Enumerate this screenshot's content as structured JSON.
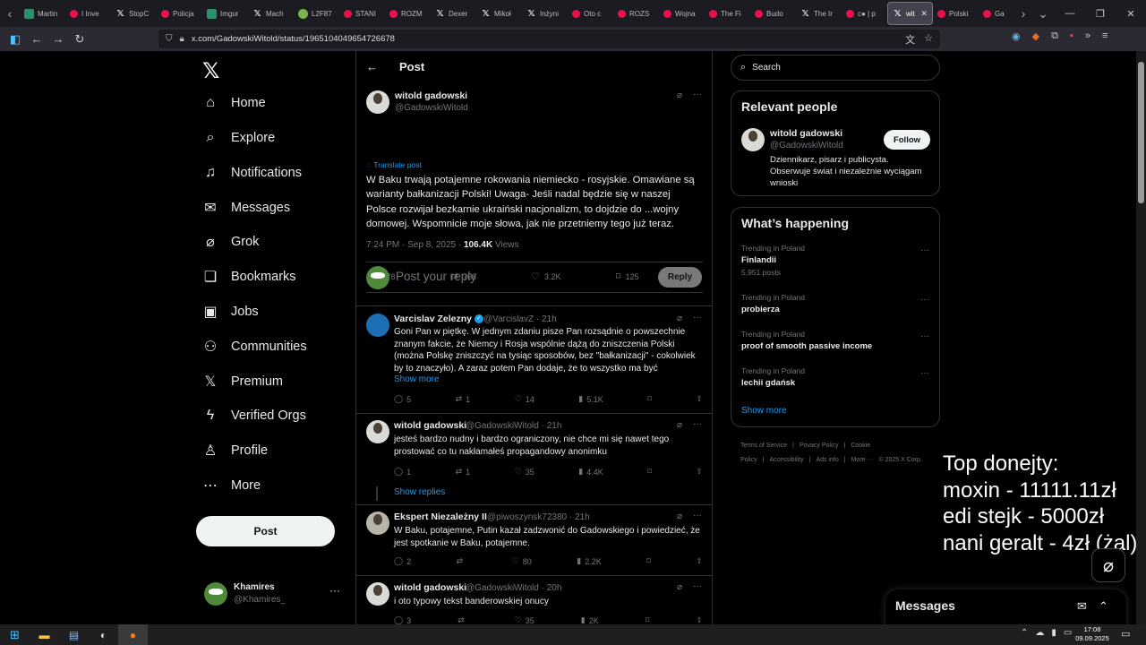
{
  "browser": {
    "tabs": [
      {
        "label": "Martin",
        "icon": "ig-icon"
      },
      {
        "label": "I Inve",
        "icon": "youtube-icon"
      },
      {
        "label": "StopC",
        "icon": "x-icon"
      },
      {
        "label": "Policja",
        "icon": "youtube-icon"
      },
      {
        "label": "Imgur",
        "icon": "ig-icon"
      },
      {
        "label": "Mach",
        "icon": "x-icon"
      },
      {
        "label": "L2F87",
        "icon": "leaf-icon"
      },
      {
        "label": "STANI",
        "icon": "youtube-icon"
      },
      {
        "label": "ROZM",
        "icon": "youtube-icon"
      },
      {
        "label": "Dexer",
        "icon": "x-icon"
      },
      {
        "label": "Mikoł",
        "icon": "x-icon"
      },
      {
        "label": "Inżyni",
        "icon": "x-icon"
      },
      {
        "label": "Oto c",
        "icon": "youtube-icon"
      },
      {
        "label": "ROZS",
        "icon": "youtube-icon"
      },
      {
        "label": "Wojna",
        "icon": "youtube-icon"
      },
      {
        "label": "The Fi",
        "icon": "youtube-icon"
      },
      {
        "label": "Budo",
        "icon": "youtube-icon"
      },
      {
        "label": "The Ir",
        "icon": "x-icon"
      },
      {
        "label": "c● | p",
        "icon": "youtube-icon"
      },
      {
        "label": "wit",
        "icon": "x-icon",
        "active": true
      },
      {
        "label": "Polski",
        "icon": "youtube-icon"
      },
      {
        "label": "Ga",
        "icon": "youtube-icon"
      }
    ],
    "url": "x.com/GadowskiWitold/status/1965104049654726678"
  },
  "nav": {
    "logo": "𝕏",
    "items": [
      {
        "label": "Home",
        "icon": "⌂"
      },
      {
        "label": "Explore",
        "icon": "⌕"
      },
      {
        "label": "Notifications",
        "icon": "♫"
      },
      {
        "label": "Messages",
        "icon": "✉"
      },
      {
        "label": "Grok",
        "icon": "⌀"
      },
      {
        "label": "Bookmarks",
        "icon": "❏"
      },
      {
        "label": "Jobs",
        "icon": "▣"
      },
      {
        "label": "Communities",
        "icon": "⚇"
      },
      {
        "label": "Premium",
        "icon": "𝕏"
      },
      {
        "label": "Verified Orgs",
        "icon": "ϟ"
      },
      {
        "label": "Profile",
        "icon": "♙"
      },
      {
        "label": "More",
        "icon": "⋯"
      }
    ],
    "post_button": "Post",
    "account": {
      "name": "Khamires",
      "handle": "@Khamires_"
    }
  },
  "post_header": {
    "title": "Post"
  },
  "main_post": {
    "author": "witold gadowski",
    "handle": "@GadowskiWitold",
    "translate": "Translate post",
    "text": "W Baku trwają potajemne rokowania niemiecko - rosyjskie. Omawiane są warianty bałkanizacji Polski! Uwaga- Jeśli nadal będzie się w naszej Polsce rozwijał bezkarnie ukraiński nacjonalizm, to dojdzie do ...wojny domowej. Wspomnicie moje słowa, jak nie przetniemy tego już teraz.",
    "timestamp": "7:24 PM · Sep 8, 2025 · ",
    "views": "106.4K",
    "views_label": " Views",
    "stats": {
      "replies": "178",
      "reposts": "768",
      "likes": "3.2K",
      "bookmarks": "125"
    }
  },
  "reply_composer": {
    "placeholder": "Post your reply",
    "button": "Reply"
  },
  "replies": [
    {
      "author": "Varcislav Zelezny",
      "handle": "@VarcislavZ · 21h",
      "text": "Goni Pan w piętkę. W jednym zdaniu pisze Pan rozsądnie o powszechnie znanym fakcie, że Niemcy i Rosja wspólnie dążą do zniszczenia Polski (można Polskę zniszczyć na tysiąc sposobów, bez \"bałkanizacji\" - cokolwiek by to znaczyło). A zaraz potem Pan dodaje, że to wszystko ma być",
      "show_more": "Show more",
      "stats": {
        "replies": "5",
        "reposts": "1",
        "likes": "14",
        "views": "5.1K"
      }
    },
    {
      "author": "witold gadowski",
      "handle": "@GadowskiWitold · 21h",
      "text": "jesteś bardzo nudny i bardzo ograniczony, nie chce mi się nawet tego prostować co tu nakłamałeś propagandowy anonimku",
      "stats": {
        "replies": "1",
        "reposts": "1",
        "likes": "35",
        "views": "4.4K"
      }
    },
    {
      "author": "Ekspert Niezależny II",
      "handle": "@piwoszynsk72380 · 21h",
      "text": "W Baku, potajemne, Putin kazał zadzwonić do Gadowskiego i powiedzieć, że jest spotkanie w Baku, potajemne.",
      "stats": {
        "replies": "2",
        "reposts": "",
        "likes": "80",
        "views": "2.2K"
      }
    },
    {
      "author": "witold gadowski",
      "handle": "@GadowskiWitold · 20h",
      "text": "i oto typowy tekst banderowskiej onucy",
      "stats": {
        "replies": "3",
        "reposts": "",
        "likes": "35",
        "views": "2K"
      }
    }
  ],
  "show_replies": "Show replies",
  "search": {
    "placeholder": "Search"
  },
  "relevant_people": {
    "title": "Relevant people",
    "name": "witold gadowski",
    "handle": "@GadowskiWitold",
    "follow": "Follow",
    "bio": "Dziennikarz, pisarz i publicysta. Obserwuje świat i niezależnie wyciągam wnioski"
  },
  "whats_happening": {
    "title": "What’s happening",
    "trends": [
      {
        "category": "Trending in Poland",
        "name": "Finlandii",
        "posts": "5,951 posts"
      },
      {
        "category": "Trending in Poland",
        "name": "probierza",
        "posts": ""
      },
      {
        "category": "Trending in Poland",
        "name": "proof of smooth passive income",
        "posts": ""
      },
      {
        "category": "Trending in Poland",
        "name": "lechii gdańsk",
        "posts": ""
      }
    ],
    "show_more": "Show more"
  },
  "footer": {
    "links": [
      "Terms of Service",
      "|",
      "Privacy Policy",
      "|",
      "Cookie Policy",
      "|",
      "Accessibility",
      "|",
      "Ads info",
      "|",
      "More ···",
      "© 2025 X Corp."
    ]
  },
  "overlay": {
    "line1": "Top donejty:",
    "line2": "moxin - 11111.11zł",
    "line3": "edi stejk - 5000zł",
    "line4": "nani geralt - 4zł (żal)"
  },
  "messages_drawer": {
    "title": "Messages"
  },
  "taskbar": {
    "time": "17:08",
    "date": "09.09.2025"
  }
}
